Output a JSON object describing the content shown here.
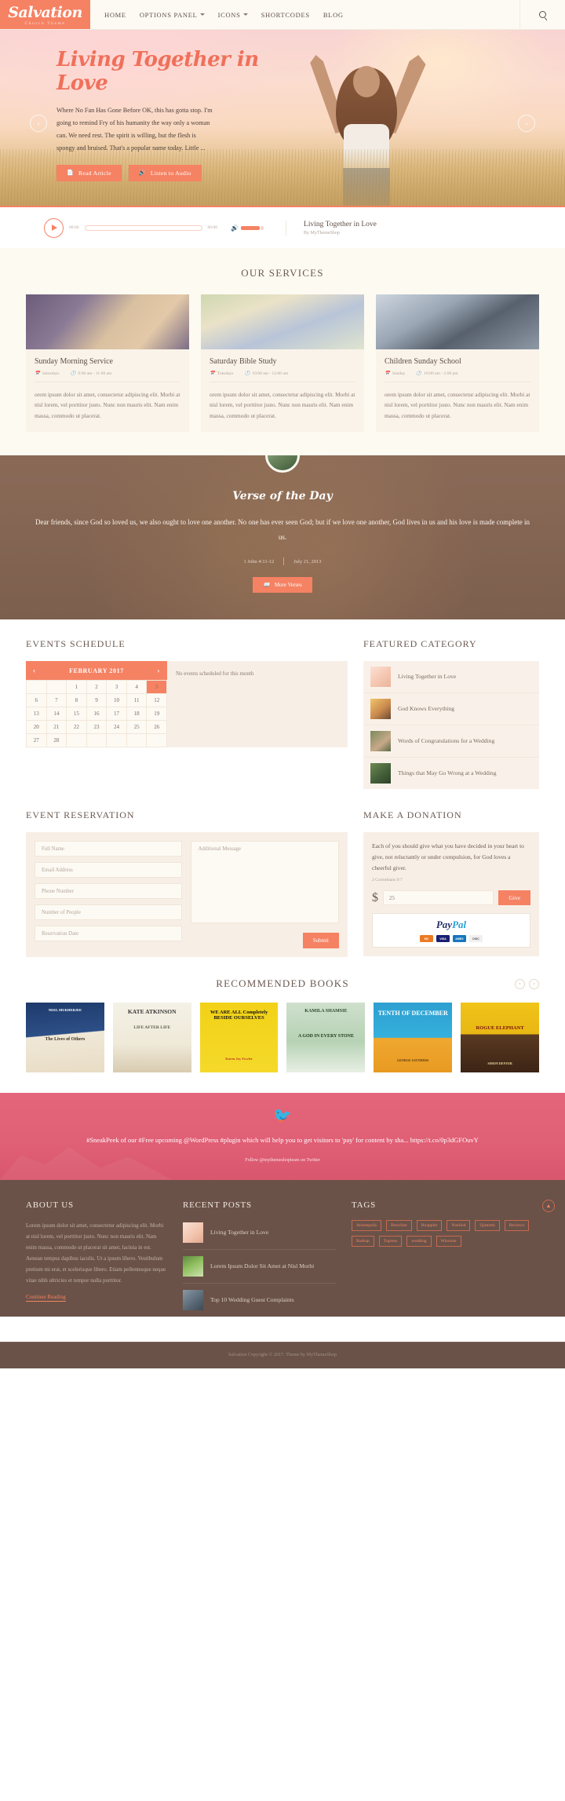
{
  "header": {
    "logo_name": "Salvation",
    "logo_tagline": "Church Theme",
    "nav": [
      {
        "label": "HOME",
        "has_caret": false
      },
      {
        "label": "OPTIONS PANEL",
        "has_caret": true
      },
      {
        "label": "ICONS",
        "has_caret": true
      },
      {
        "label": "SHORTCODES",
        "has_caret": false
      },
      {
        "label": "BLOG",
        "has_caret": false
      }
    ],
    "search_icon": "search-icon"
  },
  "hero": {
    "title": "Living Together in Love",
    "text": "Where No Fan Has Gone Before OK, this has gotta stop. I'm going to remind Fry of his humanity the way only a woman can. We need rest. The spirit is willing, but the flesh is spongy and bruised. That's a popular name today. Little ...",
    "btn_read": "Read Article",
    "btn_listen": "Listen to Audio",
    "prev": "‹",
    "next": "›"
  },
  "audio": {
    "time_start": "00:00",
    "time_end": "00:00",
    "title": "Living Together in Love",
    "by": "By MyThemeShop"
  },
  "services": {
    "title": "OUR SERVICES",
    "cards": [
      {
        "title": "Sunday Morning Service",
        "day": "Saturdays",
        "time": "9:00 am - 11:00 am",
        "desc": "orem ipsum dolor sit amet, consectetur adipiscing elit. Morbi at nisl lorem, vel porttitor justo. Nunc non mauris elit. Nam enim massa, commodo ut placerat."
      },
      {
        "title": "Saturday Bible Study",
        "day": "Tuesdays",
        "time": "10:00 am - 12:00 am",
        "desc": "orem ipsum dolor sit amet, consectetur adipiscing elit. Morbi at nisl lorem, vel porttitor justo. Nunc non mauris elit. Nam enim massa, commodo ut placerat."
      },
      {
        "title": "Children Sunday School",
        "day": "Sunday",
        "time": "10:00 am - 2:00 pm",
        "desc": "orem ipsum dolor sit amet, consectetur adipiscing elit. Morbi at nisl lorem, vel porttitor justo. Nunc non mauris elit. Nam enim massa, commodo ut placerat."
      }
    ]
  },
  "verse": {
    "heading": "Verse of the Day",
    "text": "Dear friends, since God so loved us, we also ought to love one another. No one has ever seen God; but if we love one another, God lives in us and his love is made complete in us.",
    "reference": "1 John 4:11-12",
    "date": "July 21, 2013",
    "button": "More Verses"
  },
  "events": {
    "title": "EVENTS SCHEDULE",
    "month": "FEBRUARY 2017",
    "prev": "‹",
    "next": "›",
    "today": "5",
    "weeks": [
      [
        "",
        "",
        "1",
        "2",
        "3",
        "4",
        "5"
      ],
      [
        "6",
        "7",
        "8",
        "9",
        "10",
        "11",
        "12"
      ],
      [
        "13",
        "14",
        "15",
        "16",
        "17",
        "18",
        "19"
      ],
      [
        "20",
        "21",
        "22",
        "23",
        "24",
        "25",
        "26"
      ],
      [
        "27",
        "28",
        "",
        "",
        "",
        "",
        ""
      ]
    ],
    "empty_message": "No events scheduled for this month"
  },
  "featured": {
    "title": "FEATURED CATEGORY",
    "items": [
      {
        "label": "Living Together in Love"
      },
      {
        "label": "God Knows Everything"
      },
      {
        "label": "Words of Congratulations for a Wedding"
      },
      {
        "label": "Things that May Go Wrong at a Wedding"
      }
    ]
  },
  "reservation": {
    "title": "EVENT RESERVATION",
    "fields": [
      {
        "placeholder": "Full Name"
      },
      {
        "placeholder": "Email Address"
      },
      {
        "placeholder": "Phone Number"
      },
      {
        "placeholder": "Number of People"
      },
      {
        "placeholder": "Reservation Date"
      }
    ],
    "message_placeholder": "Additional Message",
    "submit": "Submit"
  },
  "donation": {
    "title": "MAKE A DONATION",
    "text": "Each of you should give what you have decided in your heart to give, not reluctantly or under compulsion, for God loves a cheerful giver.",
    "reference": "2 Corinthians 9:7",
    "currency": "$",
    "amount": "25",
    "give": "Give",
    "paypal_pay": "Pay",
    "paypal_pal": "Pal",
    "cards": [
      "MC",
      "VISA",
      "AMEX",
      "DISC"
    ]
  },
  "books": {
    "title": "RECOMMENDED BOOKS",
    "prev": "‹",
    "next": "›",
    "items": [
      {
        "title": "The Lives of Others",
        "author": "NEEL MUKHERJEE"
      },
      {
        "title": "LIFE AFTER LIFE",
        "author": "KATE ATKINSON"
      },
      {
        "title": "WE ARE ALL Completely BESIDE OURSELVES",
        "author": "Karen Joy Fowler"
      },
      {
        "title": "A GOD IN EVERY STONE",
        "author": "KAMILA SHAMSIE"
      },
      {
        "title": "TENTH OF DECEMBER",
        "author": "GEORGE SAUNDERS"
      },
      {
        "title": "ROGUE ELEPHANT",
        "author": "SIMON DENYER"
      }
    ]
  },
  "twitter": {
    "icon": "twitter-bird-icon",
    "text": "#SneakPeek of our #Free upcoming @WordPress #plugin which will help you to get visitors to 'pay' for content by sha... https://t.co/0p3dGFOuvY",
    "follow": "Follow @mythemeshopteam on Twitter"
  },
  "footer": {
    "about_title": "ABOUT US",
    "about_text": "Lorem ipsum dolor sit amet, consectetur adipiscing elit. Morbi at nisl lorem, vel porttitor justo. Nunc non mauris elit. Nam enim massa, commodo ut placerat sit amet, lacinia in est. Aenean tempus dapibus iaculis. Ut a ipsum libero. Vestibulum pretium mi erat, et scelerisque libero. Etiam pellentesque neque vitae nibh ultricies et tempor nulla porttitor.",
    "continue": "Continue Reading",
    "recent_title": "RECENT POSTS",
    "recent": [
      {
        "title": "Living Together in Love"
      },
      {
        "title": "Lorem Ipsum Dolor Sit Amet at Nisl Morbi"
      },
      {
        "title": "Top 10 Wedding Guest Complaints"
      }
    ],
    "tags_title": "TAGS",
    "tags": [
      "Animepolis",
      "Brewline",
      "Hoappler",
      "Noelind",
      "Qiameth",
      "Reviews",
      "Rodrup",
      "Tupress",
      "wedding",
      "Winooze"
    ],
    "copyright": "Salvation Copyright © 2017. Theme by MyThemeShop",
    "to_top": "▲"
  },
  "colors": {
    "accent": "#f58263",
    "verse_bg": "#7d5f4e",
    "twitter_bg": "#e06076",
    "footer_bg": "#6a5248"
  }
}
